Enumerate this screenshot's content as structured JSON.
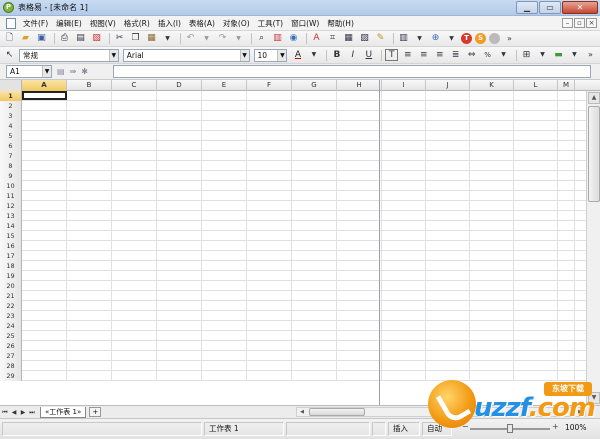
{
  "window": {
    "title": "表格易 - [未命名 1]"
  },
  "menu": [
    "文件(F)",
    "编辑(E)",
    "视图(V)",
    "格式(R)",
    "插入(I)",
    "表格(A)",
    "对象(O)",
    "工具(T)",
    "窗口(W)",
    "帮助(H)"
  ],
  "format_bar": {
    "style": "常规",
    "font": "Arial",
    "size": "10"
  },
  "formula_bar": {
    "cell_ref": "A1",
    "value": ""
  },
  "columns": [
    "A",
    "B",
    "C",
    "D",
    "E",
    "F",
    "G",
    "H",
    "I",
    "J",
    "K",
    "L",
    "M"
  ],
  "rows": [
    "1",
    "2",
    "3",
    "4",
    "5",
    "6",
    "7",
    "8",
    "9",
    "10",
    "11",
    "12",
    "13",
    "14",
    "15",
    "16",
    "17",
    "18",
    "19",
    "20",
    "21",
    "22",
    "23",
    "24",
    "25",
    "26",
    "27",
    "28",
    "29"
  ],
  "sheet_tab": "«工作表 1»",
  "status": {
    "sheet": "工作表 1",
    "mode": "插入",
    "calc": "自动",
    "zoom": "100%"
  },
  "watermark": {
    "brand": "uzzf",
    "tld": ".com",
    "subtitle": "东坡下载"
  }
}
